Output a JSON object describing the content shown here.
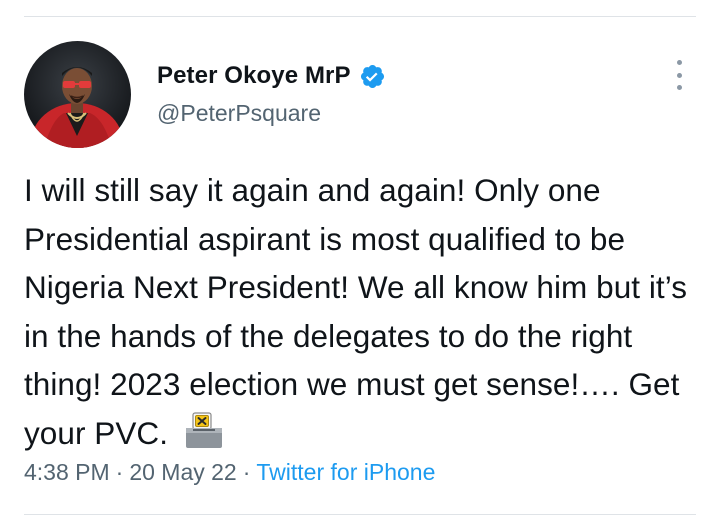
{
  "author": {
    "display_name": "Peter Okoye MrP",
    "handle": "@PeterPsquare",
    "verified": true
  },
  "tweet": {
    "text": "I will still say it again and again! Only one Presidential aspirant is most qualified to be Nigeria Next President! We all know him but it’s in the hands of the delegates to do the right thing! 2023 election we must get sense!…. Get your PVC.",
    "emoji": "ballot-box-icon"
  },
  "meta": {
    "time": "4:38 PM",
    "separator": "·",
    "date": "20 May 22",
    "source": "Twitter for iPhone"
  },
  "colors": {
    "verified_badge": "#1d9bf0",
    "secondary_text": "#536471",
    "link": "#1d9bf0"
  }
}
